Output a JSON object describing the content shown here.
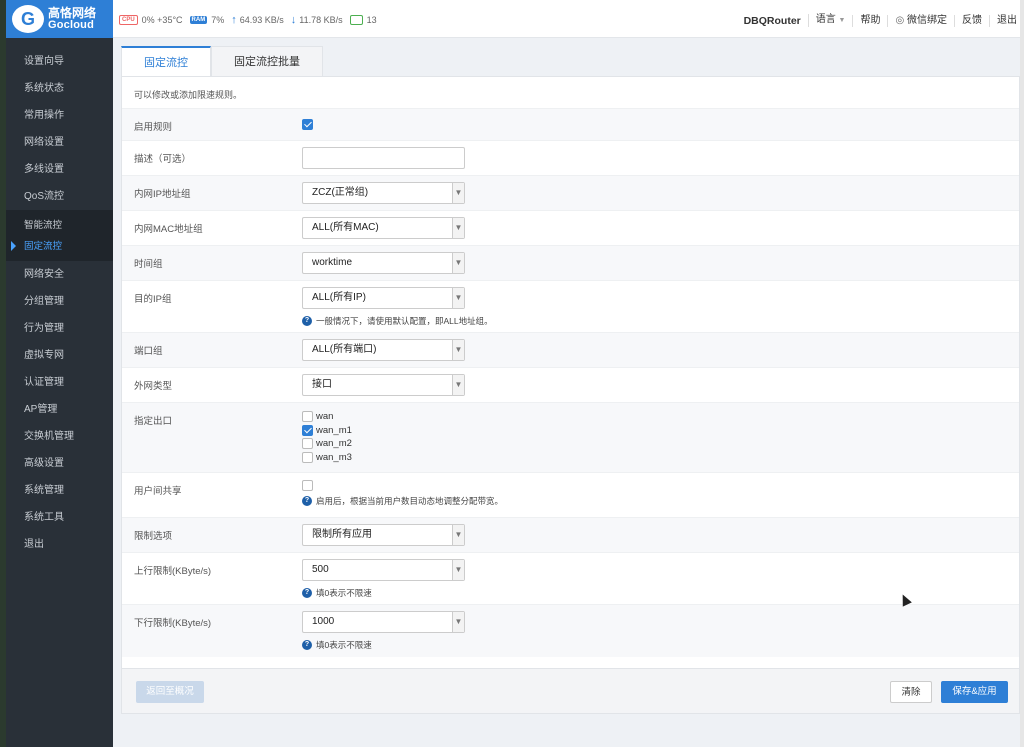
{
  "logo": {
    "cn": "高恪网络",
    "en": "Gocloud",
    "mark": "G"
  },
  "sidebar": {
    "items": [
      "设置向导",
      "系统状态",
      "常用操作",
      "网络设置",
      "多线设置",
      "QoS流控"
    ],
    "sub": [
      "智能流控",
      "固定流控"
    ],
    "items2": [
      "网络安全",
      "分组管理",
      "行为管理",
      "虚拟专网",
      "认证管理",
      "AP管理",
      "交换机管理",
      "高级设置",
      "系统管理",
      "系统工具",
      "退出"
    ]
  },
  "topbar": {
    "cpu_chip": "CPU",
    "cpu": "0% +35°C",
    "ram_chip": "RAM",
    "ram": "7%",
    "up": "64.93 KB/s",
    "down": "11.78 KB/s",
    "devices": "13",
    "brand": "DBQRouter",
    "lang": "语言",
    "help": "帮助",
    "wechat": "微信绑定",
    "feedback": "反馈",
    "logout": "退出"
  },
  "tabs": [
    "固定流控",
    "固定流控批量"
  ],
  "desc": "可以修改或添加限速规则。",
  "form": {
    "enable": {
      "label": "启用规则",
      "checked": true
    },
    "describe": {
      "label": "描述（可选）",
      "value": ""
    },
    "ipgroup": {
      "label": "内网IP地址组",
      "value": "ZCZ(正常组)"
    },
    "macgroup": {
      "label": "内网MAC地址组",
      "value": "ALL(所有MAC)"
    },
    "timegroup": {
      "label": "时间组",
      "value": "worktime"
    },
    "dstip": {
      "label": "目的IP组",
      "value": "ALL(所有IP)",
      "hint": "一般情况下，请使用默认配置，即ALL地址组。"
    },
    "port": {
      "label": "端口组",
      "value": "ALL(所有端口)"
    },
    "wantype": {
      "label": "外网类型",
      "value": "接口"
    },
    "outlet": {
      "label": "指定出口",
      "options": [
        {
          "name": "wan",
          "checked": false
        },
        {
          "name": "wan_m1",
          "checked": true
        },
        {
          "name": "wan_m2",
          "checked": false
        },
        {
          "name": "wan_m3",
          "checked": false
        }
      ]
    },
    "share": {
      "label": "用户间共享",
      "checked": false,
      "hint": "启用后，根据当前用户数目动态地调整分配带宽。"
    },
    "limit": {
      "label": "限制选项",
      "value": "限制所有应用"
    },
    "up": {
      "label": "上行限制(KByte/s)",
      "value": "500",
      "hint": "填0表示不限速"
    },
    "down": {
      "label": "下行限制(KByte/s)",
      "value": "1000",
      "hint": "填0表示不限速"
    }
  },
  "footer": {
    "back": "返回至概况",
    "clear": "清除",
    "save": "保存&应用"
  }
}
